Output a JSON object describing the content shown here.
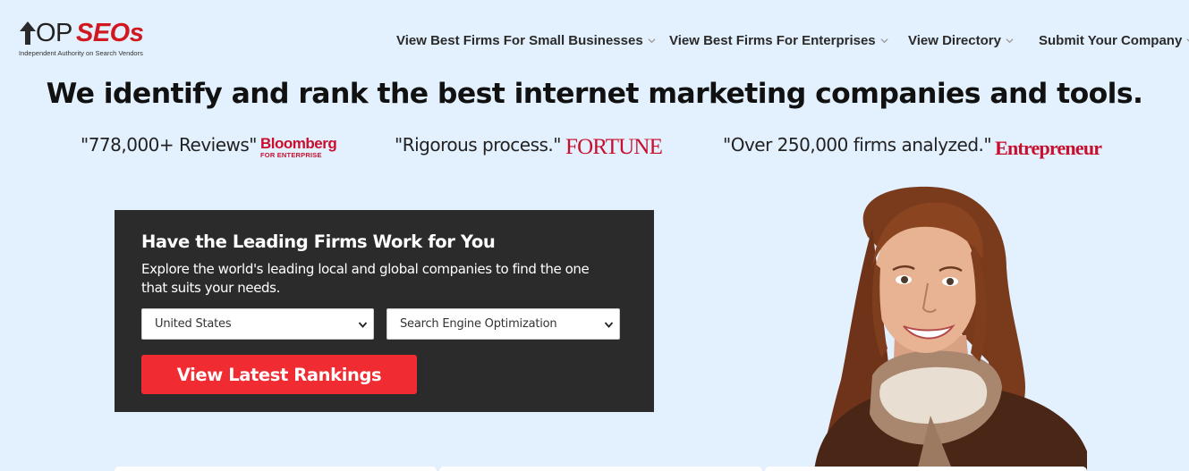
{
  "logo": {
    "op_text": "OP",
    "seos_text": "SEOs",
    "tagline": "Independent Authority on Search Vendors",
    "icon": "arrow-up-icon"
  },
  "nav": {
    "items": [
      {
        "label": "View Best Firms For Small Businesses",
        "icon": "chevron-down-icon"
      },
      {
        "label": "View Best Firms For Enterprises",
        "icon": "chevron-down-icon"
      },
      {
        "label": "View Directory",
        "icon": "chevron-down-icon"
      },
      {
        "label": "Submit Your Company",
        "icon": "chevron-down-icon"
      }
    ]
  },
  "headline": "We identify and rank the best internet marketing companies and tools.",
  "press": [
    {
      "quote": "\"778,000+ Reviews\"",
      "source": "Bloomberg",
      "source_sub": "FOR ENTERPRISE"
    },
    {
      "quote": "\"Rigorous process.\"",
      "source": "FORTUNE"
    },
    {
      "quote": "\"Over 250,000 firms analyzed.\"",
      "source": "Entrepreneur"
    }
  ],
  "panel": {
    "title": "Have the Leading Firms Work for You",
    "description": "Explore the world's leading local and global companies to find the one that suits your needs.",
    "country_select": {
      "value": "United States"
    },
    "service_select": {
      "value": "Search Engine Optimization"
    },
    "cta_label": "View Latest Rankings"
  },
  "colors": {
    "page_bg": "#e3f0fd",
    "brand_red": "#d11820",
    "cta_red": "#f12b32",
    "panel_bg": "#2b2b2b"
  }
}
